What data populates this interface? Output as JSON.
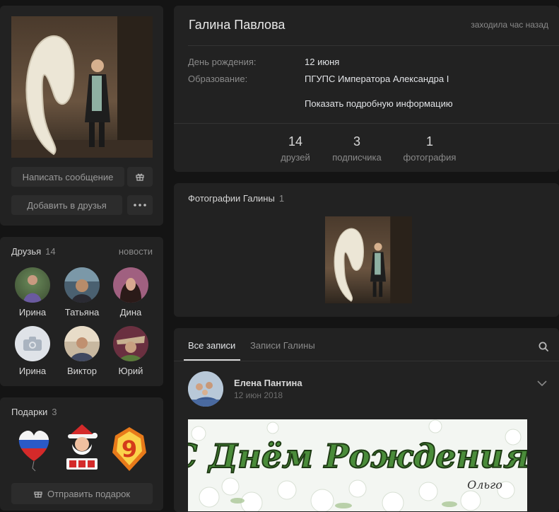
{
  "profile": {
    "name": "Галина Павлова",
    "last_seen": "заходила час назад",
    "birthday_label": "День рождения:",
    "birthday_value": "12 июня",
    "education_label": "Образование:",
    "education_value": "ПГУПС Императора Александра I",
    "more_info": "Показать подробную информацию",
    "write_message": "Написать сообщение",
    "add_friend": "Добавить в друзья"
  },
  "stats": [
    {
      "num": "14",
      "label": "друзей"
    },
    {
      "num": "3",
      "label": "подписчика"
    },
    {
      "num": "1",
      "label": "фотография"
    }
  ],
  "friends": {
    "title": "Друзья",
    "count": "14",
    "news_link": "новости",
    "items": [
      {
        "name": "Ирина"
      },
      {
        "name": "Татьяна"
      },
      {
        "name": "Дина"
      },
      {
        "name": "Ирина"
      },
      {
        "name": "Виктор"
      },
      {
        "name": "Юрий"
      }
    ]
  },
  "gifts": {
    "title": "Подарки",
    "count": "3",
    "send_label": "Отправить подарок"
  },
  "photos": {
    "title": "Фотографии Галины",
    "count": "1"
  },
  "wall": {
    "tab_all": "Все записи",
    "tab_own": "Записи Галины",
    "post": {
      "author": "Елена Пантина",
      "date": "12 июн 2018",
      "card_text": "С Днём Рождения!",
      "card_signature": "Ольго"
    }
  }
}
